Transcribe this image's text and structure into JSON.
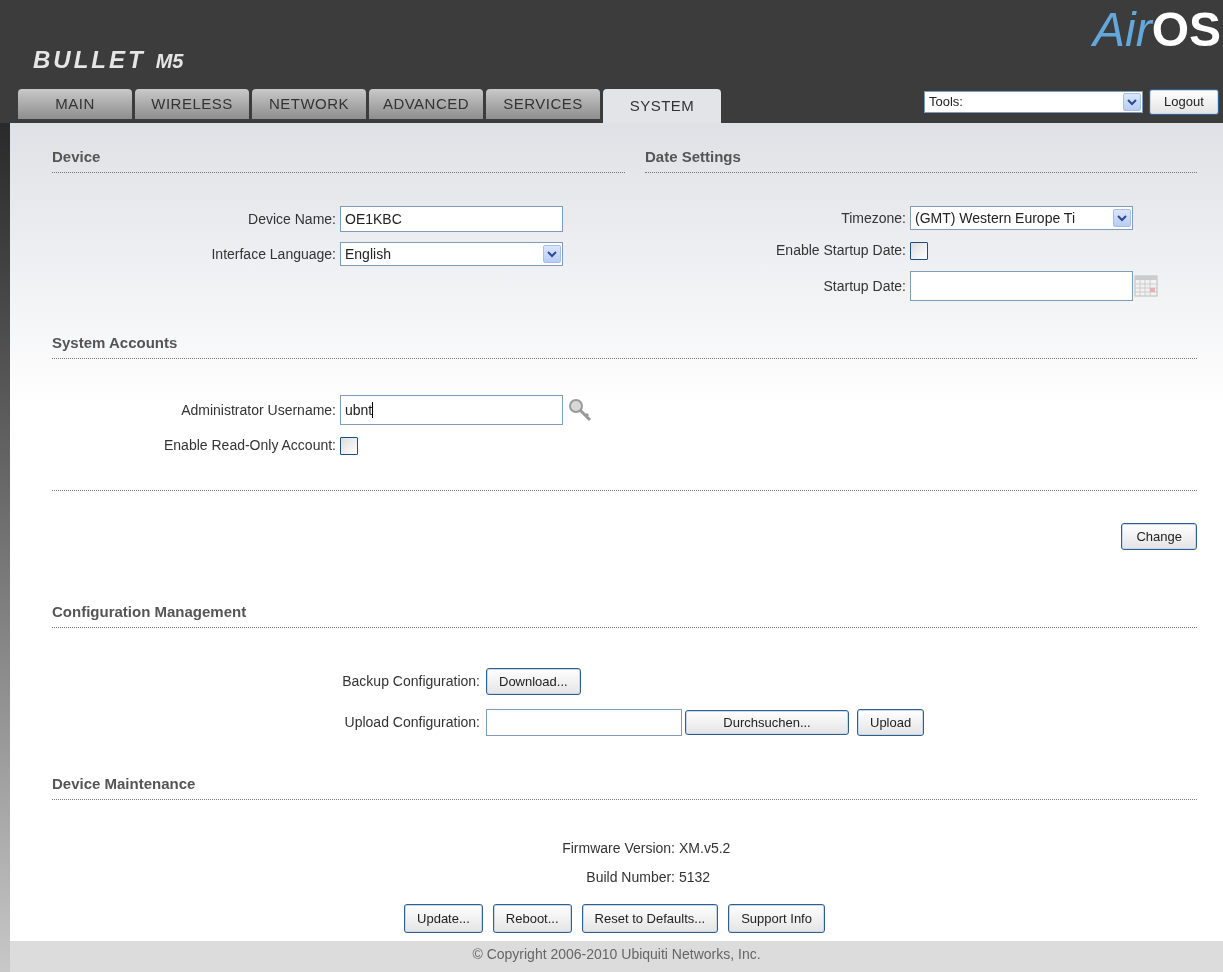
{
  "brand": {
    "product": "BULLET",
    "model": "M5",
    "logo_air": "Air",
    "logo_os": "OS"
  },
  "tabs": [
    {
      "label": "MAIN",
      "selected": false
    },
    {
      "label": "WIRELESS",
      "selected": false
    },
    {
      "label": "NETWORK",
      "selected": false
    },
    {
      "label": "ADVANCED",
      "selected": false
    },
    {
      "label": "SERVICES",
      "selected": false
    },
    {
      "label": "SYSTEM",
      "selected": true
    }
  ],
  "tools": {
    "value": "Tools:",
    "logout": "Logout"
  },
  "device": {
    "title": "Device",
    "fields": [
      {
        "kind": "text",
        "label": "Device Name:",
        "value": "OE1KBC"
      },
      {
        "kind": "select",
        "label": "Interface Language:",
        "value": "English"
      }
    ]
  },
  "date_settings": {
    "title": "Date Settings",
    "fields": [
      {
        "kind": "select",
        "label": "Timezone:",
        "value": "(GMT) Western Europe Ti"
      },
      {
        "kind": "checkbox",
        "label": "Enable Startup Date:",
        "checked": false
      },
      {
        "kind": "date",
        "label": "Startup Date:"
      }
    ]
  },
  "system_accounts": {
    "title": "System Accounts",
    "fields": [
      {
        "kind": "key",
        "label": "Administrator Username:",
        "value": "ubnt"
      },
      {
        "kind": "checkbox",
        "label": "Enable Read-Only Account:",
        "checked": false
      }
    ],
    "change": "Change"
  },
  "configuration": {
    "title": "Configuration Management",
    "backup_label": "Backup Configuration:",
    "download": "Download...",
    "upload_label": "Upload Configuration:",
    "browse": "Durchsuchen...",
    "upload": "Upload"
  },
  "maintenance": {
    "title": "Device Maintenance",
    "info": [
      {
        "label": "Firmware Version:",
        "value": "XM.v5.2"
      },
      {
        "label": "Build Number:",
        "value": "5132"
      }
    ],
    "buttons": [
      "Update...",
      "Reboot...",
      "Reset to Defaults...",
      "Support Info"
    ]
  },
  "footer": "© Copyright 2006-2010 Ubiquiti Networks, Inc."
}
